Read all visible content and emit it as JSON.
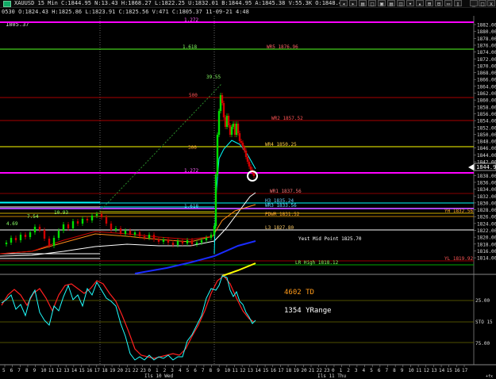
{
  "window": {
    "title": "XAUUSD 15 Min  C:1844.95 N:13.43 H:1868.27 L:1822.25 U:1832.01 B:1844.95 A:1845.38 V:55.3K  O:1848.40",
    "minimize": "_",
    "maximize": "□",
    "close": "x",
    "buttons": [
      "◂",
      "▸",
      "▤",
      "□",
      "▣",
      "▤",
      "◫",
      "▾",
      "▴",
      "⊞",
      "⊟",
      "▭",
      "▯"
    ]
  },
  "status_line": "0530 O:1824.43 H:1825.86 L:1823.91 C:1825.56 V:471  C:1805.37 11-09-21  4:48",
  "corner_value": "1805.37",
  "price_axis": {
    "labels": [
      "1882.00",
      "1880.00",
      "1878.00",
      "1876.00",
      "1874.00",
      "1872.00",
      "1870.00",
      "1868.00",
      "1866.00",
      "1864.00",
      "1862.00",
      "1860.00",
      "1858.00",
      "1856.00",
      "1854.00",
      "1852.00",
      "1850.00",
      "1848.00",
      "1846.00",
      "1844.00",
      "1842.00",
      "1840.00",
      "1838.00",
      "1836.00",
      "1834.00",
      "1832.00",
      "1830.00",
      "1828.00",
      "1826.00",
      "1824.00",
      "1822.00",
      "1820.00",
      "1818.00",
      "1816.00",
      "1814.00"
    ],
    "current_price": "1844.95"
  },
  "osc_axis": {
    "labels": [
      "25.00",
      "STO 15",
      "75.00"
    ]
  },
  "level_labels": [
    "1.272",
    "1.618",
    "WR5 1876.96",
    "39.55",
    "500",
    "WR2 1857.52",
    "WR4 1850.25",
    "300",
    "1.272",
    "WR1 1837.56",
    "H3 1835.24",
    "WR3 1833.56",
    "1.618",
    "YH 1832.56",
    "PDWR 1831.52",
    "L3 1827.80",
    "Yest Mid Point 1825.70",
    "YL 1819.92",
    "LR High 1818.12",
    "7.54",
    "4.69",
    "10.93"
  ],
  "overlays": {
    "td": "4602 TD",
    "yrange": "1354 YRange"
  },
  "time_axis": {
    "ticks": [
      "5",
      "6",
      "7",
      "8",
      "9",
      "10",
      "11",
      "12",
      "13",
      "14",
      "15",
      "16",
      "17",
      "18",
      "19",
      "20",
      "21",
      "22",
      "23",
      "0",
      "1",
      "2",
      "3",
      "4",
      "5",
      "6",
      "7",
      "8",
      "9",
      "10",
      "11",
      "12",
      "13",
      "14",
      "15",
      "16",
      "17",
      "18",
      "19",
      "20",
      "21",
      "22",
      "23",
      "0",
      "1",
      "2",
      "3",
      "4",
      "5",
      "6",
      "7",
      "8",
      "9",
      "10",
      "11",
      "12",
      "13",
      "14",
      "15",
      "16",
      "17"
    ],
    "day1": "Ils 10 Wed",
    "day2": "Ils 11 Thu",
    "tail": "+fx"
  },
  "colors": {
    "background": "#000000",
    "magenta": "#ff00ff",
    "yellow": "#ffff00",
    "green": "#00ff00",
    "red": "#cc0000",
    "cyan": "#00ffff",
    "white": "#ffffff",
    "blue": "#1a2cff",
    "orange": "#ff8c1a"
  }
}
